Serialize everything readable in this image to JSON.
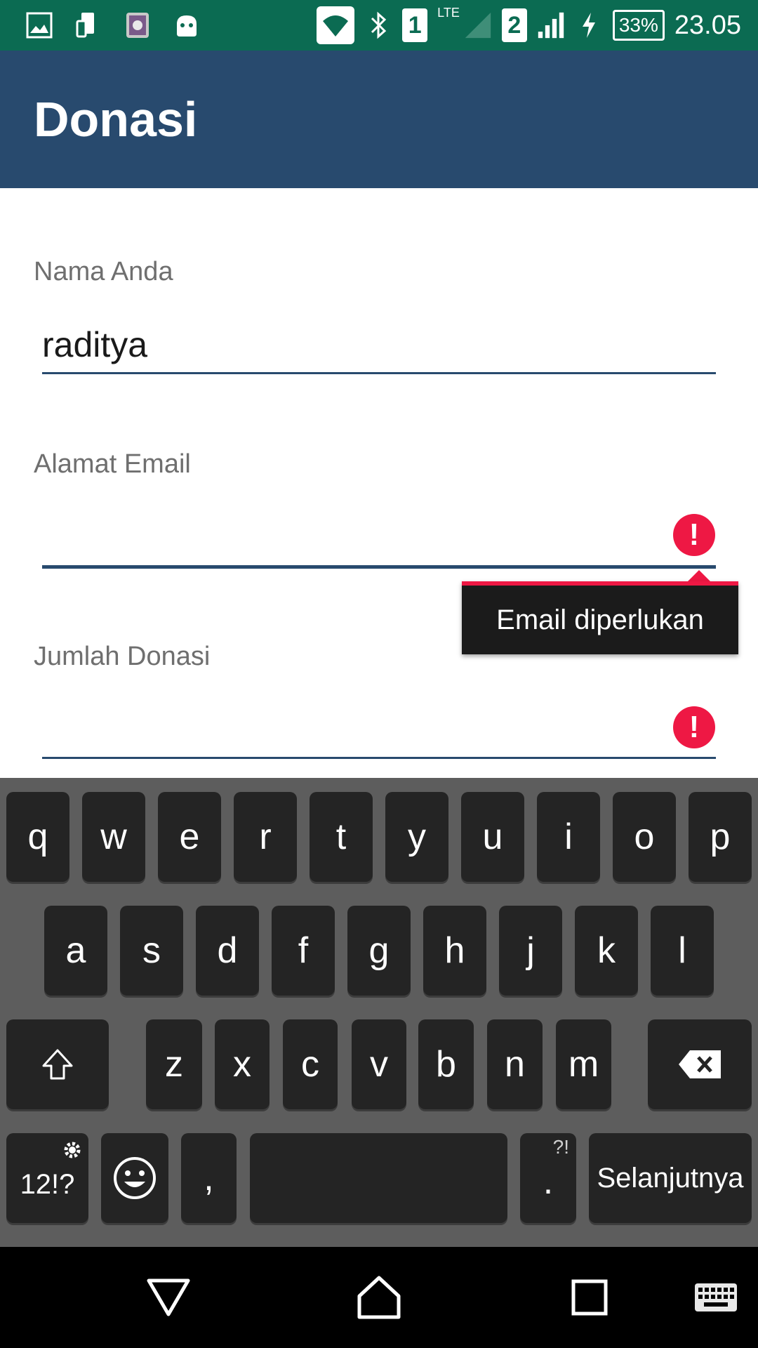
{
  "status_bar": {
    "sim1": "1",
    "sim2": "2",
    "network": "LTE",
    "battery": "33%",
    "time": "23.05"
  },
  "app_bar": {
    "title": "Donasi"
  },
  "form": {
    "name": {
      "label": "Nama Anda",
      "value": "raditya"
    },
    "email": {
      "label": "Alamat Email",
      "value": "",
      "error": "Email diperlukan"
    },
    "amount": {
      "label": "Jumlah Donasi",
      "value": ""
    }
  },
  "colors": {
    "status_bar": "#0b6b52",
    "app_bar": "#284a6e",
    "error": "#ee1844",
    "keyboard_bg": "#5d5d5d",
    "key_bg": "#242424"
  },
  "keyboard": {
    "row1": [
      "q",
      "w",
      "e",
      "r",
      "t",
      "y",
      "u",
      "i",
      "o",
      "p"
    ],
    "row2": [
      "a",
      "s",
      "d",
      "f",
      "g",
      "h",
      "j",
      "k",
      "l"
    ],
    "row3": [
      "z",
      "x",
      "c",
      "v",
      "b",
      "n",
      "m"
    ],
    "symbols_key": "12!?",
    "comma_key": ",",
    "period_key": ".",
    "period_hint": "?!",
    "action_key": "Selanjutnya",
    "icons": {
      "shift": "shift-icon",
      "backspace": "backspace-icon",
      "emoji": "emoji-icon",
      "settings": "gear-icon"
    }
  },
  "nav_bar": {
    "icons": [
      "back-icon",
      "home-icon",
      "recents-icon",
      "keyboard-icon"
    ]
  }
}
